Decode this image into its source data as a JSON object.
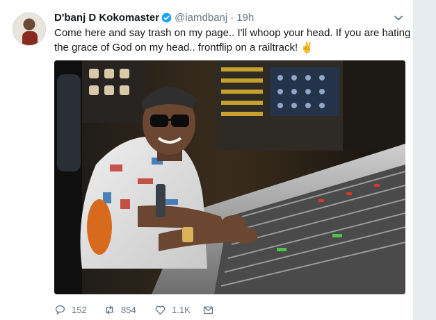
{
  "tweet": {
    "display_name": "D'banj D Kokomaster",
    "handle": "@iamdbanj",
    "separator": "·",
    "timestamp": "19h",
    "text_line1": "Come here and say trash on my page.. I'll whoop your head.    If you are hating",
    "text_line2": "the grace of God on my head.. frontflip on a railtrack! ✌"
  },
  "actions": {
    "replies": "152",
    "retweets": "854",
    "likes": "1.1K"
  },
  "icons": {
    "verified": "verified-badge-icon",
    "menu": "chevron-down-icon",
    "reply": "reply-icon",
    "retweet": "retweet-icon",
    "like": "heart-icon",
    "message": "envelope-icon"
  },
  "colors": {
    "text": "#14171a",
    "secondary": "#657786",
    "verified": "#1da1f2",
    "background": "#e6ecf0"
  }
}
